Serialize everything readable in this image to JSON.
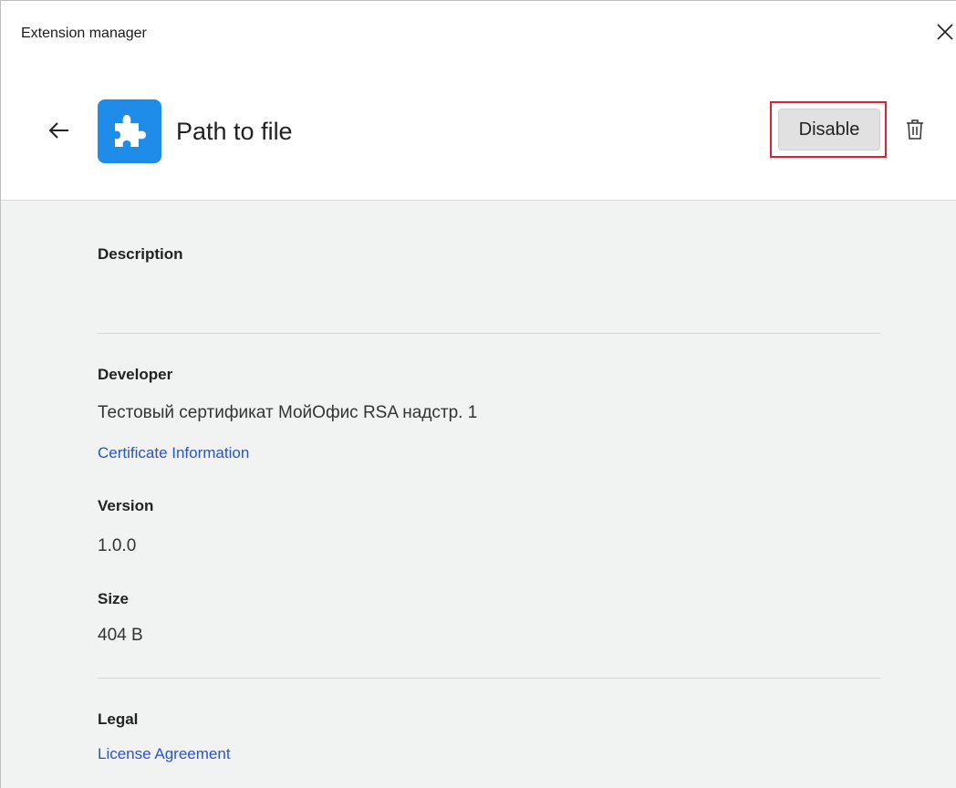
{
  "window": {
    "title": "Extension manager"
  },
  "extension": {
    "name": "Path to file",
    "disable_label": "Disable"
  },
  "details": {
    "description_label": "Description",
    "developer_label": "Developer",
    "developer_value": "Тестовый сертификат МойОфис RSA надстр. 1",
    "certificate_link": "Certificate Information",
    "version_label": "Version",
    "version_value": "1.0.0",
    "size_label": "Size",
    "size_value": "404 B",
    "legal_label": "Legal",
    "license_link": "License Agreement"
  },
  "icons": {
    "close": "close-icon",
    "back": "arrow-left-icon",
    "extension": "puzzle-piece-icon",
    "delete": "trash-icon"
  },
  "colors": {
    "accent": "#1e8ce8",
    "link": "#2753d6",
    "highlight": "#e0202c"
  }
}
